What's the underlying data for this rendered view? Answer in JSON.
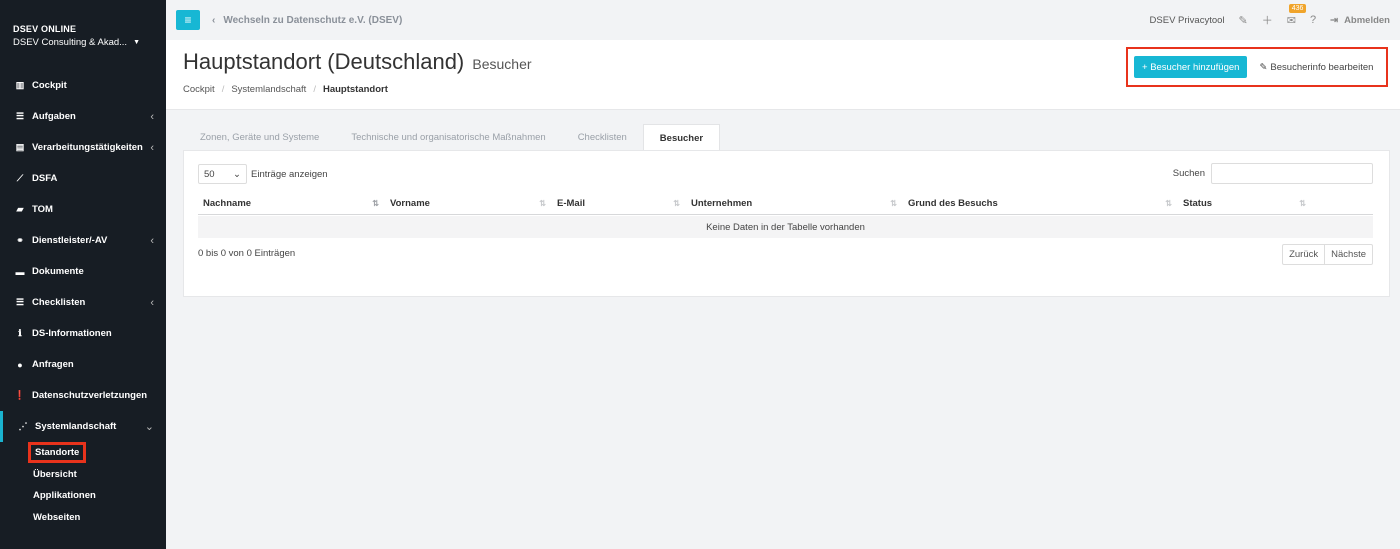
{
  "sidebar": {
    "org_name": "DSEV ONLINE",
    "org_sub": "DSEV Consulting & Akad...",
    "items": [
      {
        "label": "Cockpit",
        "icon": "chart-icon",
        "arrow": ""
      },
      {
        "label": "Aufgaben",
        "icon": "list-icon",
        "arrow": "‹"
      },
      {
        "label": "Verarbeitungstätigkeiten",
        "icon": "table-icon",
        "arrow": "‹"
      },
      {
        "label": "DSFA",
        "icon": "line-chart-icon",
        "arrow": ""
      },
      {
        "label": "TOM",
        "icon": "lock-icon",
        "arrow": ""
      },
      {
        "label": "Dienstleister/-AV",
        "icon": "handshake-icon",
        "arrow": "‹"
      },
      {
        "label": "Dokumente",
        "icon": "folder-icon",
        "arrow": ""
      },
      {
        "label": "Checklisten",
        "icon": "list-icon",
        "arrow": "‹"
      },
      {
        "label": "DS-Informationen",
        "icon": "info-icon",
        "arrow": ""
      },
      {
        "label": "Anfragen",
        "icon": "comments-icon",
        "arrow": ""
      },
      {
        "label": "Datenschutzverletzungen",
        "icon": "alert-icon",
        "arrow": ""
      },
      {
        "label": "Systemlandschaft",
        "icon": "network-icon",
        "arrow": "⌄"
      }
    ],
    "sub_items": [
      "Standorte",
      "Übersicht",
      "Applikationen",
      "Webseiten"
    ]
  },
  "topbar": {
    "back_label": "Wechseln zu Datenschutz e.V. (DSEV)",
    "app_name": "DSEV Privacytool",
    "badge_count": "436",
    "logout_label": "Abmelden"
  },
  "header": {
    "title": "Hauptstandort (Deutschland)",
    "subtitle": "Besucher",
    "breadcrumb": [
      "Cockpit",
      "Systemlandschaft",
      "Hauptstandort"
    ],
    "add_button": "Besucher hinzufügen",
    "edit_button": "Besucherinfo bearbeiten"
  },
  "tabs": [
    "Zonen, Geräte und Systeme",
    "Technische und organisatorische Maßnahmen",
    "Checklisten",
    "Besucher"
  ],
  "table": {
    "length_value": "50",
    "length_label": "Einträge anzeigen",
    "search_label": "Suchen",
    "columns": [
      "Nachname",
      "Vorname",
      "E-Mail",
      "Unternehmen",
      "Grund des Besuchs",
      "Status"
    ],
    "empty_text": "Keine Daten in der Tabelle vorhanden",
    "info": "0 bis 0 von 0 Einträgen",
    "prev": "Zurück",
    "next": "Nächste"
  }
}
